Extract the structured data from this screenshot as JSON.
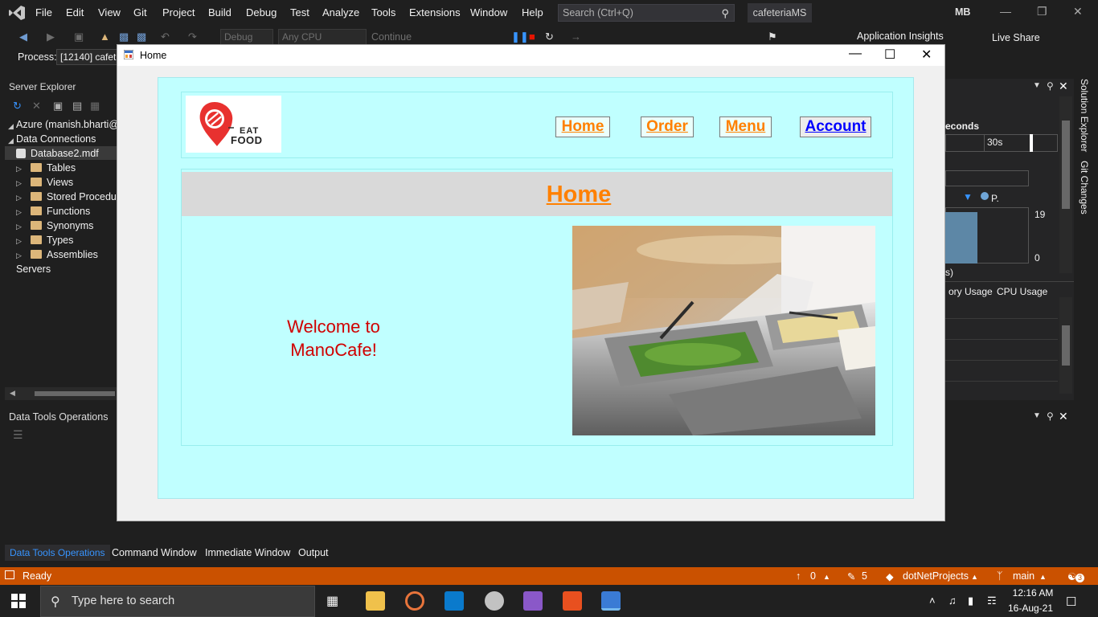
{
  "menu": {
    "items": [
      "File",
      "Edit",
      "View",
      "Git",
      "Project",
      "Build",
      "Debug",
      "Test",
      "Analyze",
      "Tools",
      "Extensions",
      "Window",
      "Help"
    ],
    "search_placeholder": "Search (Ctrl+Q)",
    "solution_name": "cafeteriaMS",
    "user_initials": "MB"
  },
  "toolbar": {
    "config": "Debug",
    "platform": "Any CPU",
    "continue": "Continue",
    "app_insights": "Application Insights",
    "live_share": "Live Share"
  },
  "process": {
    "label": "Process:",
    "value": "[12140] cafet"
  },
  "server_explorer": {
    "title": "Server Explorer",
    "azure": "Azure (manish.bharti@r",
    "data_connections": "Data Connections",
    "database": "Database2.mdf",
    "folders": [
      "Tables",
      "Views",
      "Stored Procedur",
      "Functions",
      "Synonyms",
      "Types",
      "Assemblies"
    ],
    "servers": "Servers"
  },
  "data_tools": {
    "title": "Data Tools Operations"
  },
  "diagnostics": {
    "seconds": "econds",
    "time_30s": "30s",
    "max_value": "19",
    "min_value": "0",
    "legend_p": "P.",
    "memory_tab": "ory Usage",
    "cpu_tab": "CPU Usage",
    "paren": "s)"
  },
  "side_tabs": {
    "solution_explorer": "Solution Explorer",
    "git_changes": "Git Changes"
  },
  "bottom_tabs": [
    "Data Tools Operations",
    "Command Window",
    "Immediate Window",
    "Output"
  ],
  "status": {
    "ready": "Ready",
    "up_count": "0",
    "pencil_count": "5",
    "repo": "dotNetProjects",
    "branch": "main",
    "notifications": "3"
  },
  "taskbar": {
    "search_placeholder": "Type here to search",
    "time": "12:16 AM",
    "date": "16-Aug-21"
  },
  "home_window": {
    "title": "Home",
    "logo_text_eat": "EAT",
    "logo_text_food": "FOOD",
    "nav": [
      "Home",
      "Order",
      "Menu",
      "Account"
    ],
    "heading": "Home",
    "welcome_line1": "Welcome to",
    "welcome_line2": "ManoCafe!"
  }
}
